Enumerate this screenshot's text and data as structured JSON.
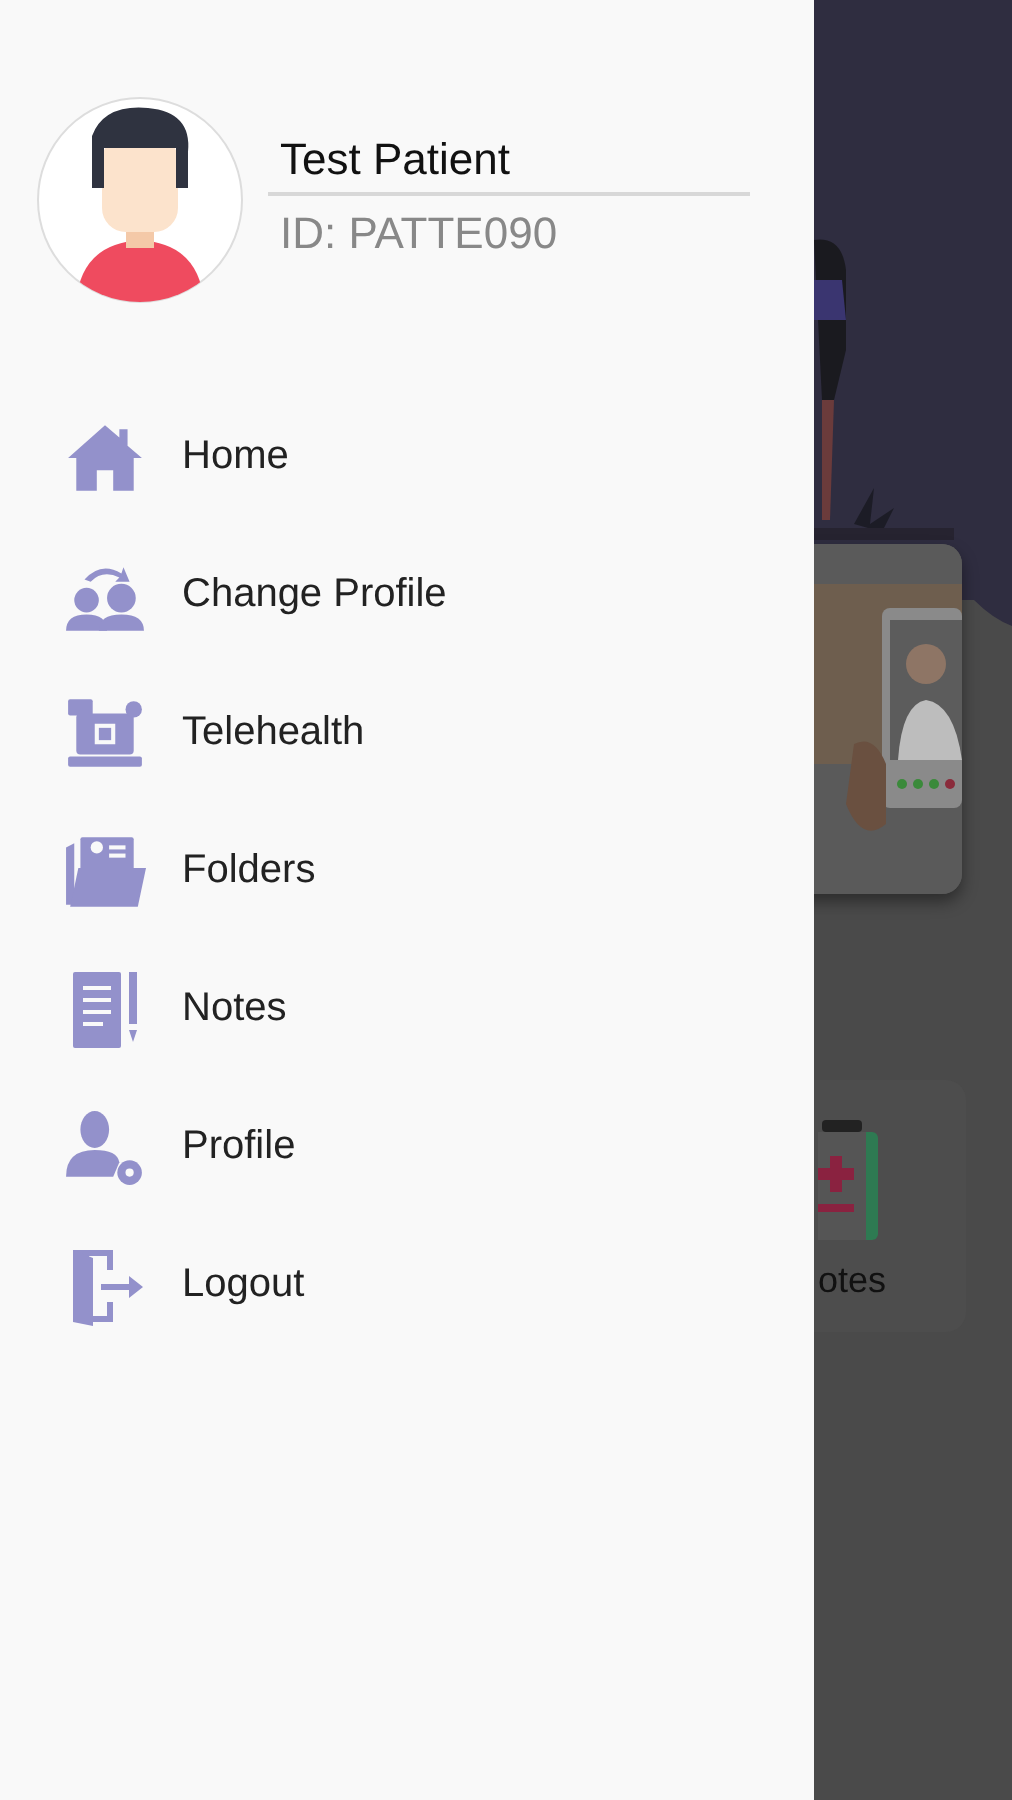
{
  "profile": {
    "name": "Test Patient",
    "id": "ID: PATTE090"
  },
  "menu": [
    {
      "label": "Home"
    },
    {
      "label": "Change Profile"
    },
    {
      "label": "Telehealth"
    },
    {
      "label": "Folders"
    },
    {
      "label": "Notes"
    },
    {
      "label": "Profile"
    },
    {
      "label": "Logout"
    }
  ],
  "background": {
    "card_label": "otes"
  }
}
